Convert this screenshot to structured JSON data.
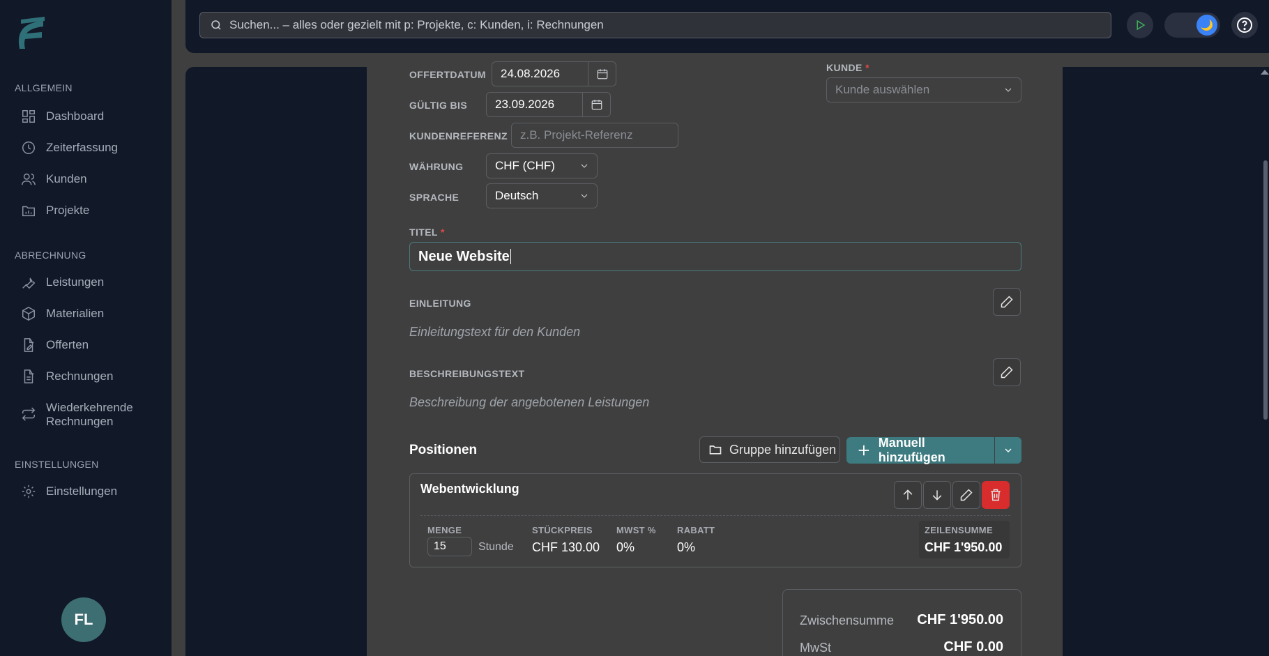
{
  "sidebar": {
    "sections": [
      {
        "label": "ALLGEMEIN"
      },
      {
        "label": "ABRECHNUNG"
      },
      {
        "label": "EINSTELLUNGEN"
      }
    ],
    "items": [
      {
        "label": "Dashboard",
        "icon": "dashboard-icon"
      },
      {
        "label": "Zeiterfassung",
        "icon": "clock-icon"
      },
      {
        "label": "Kunden",
        "icon": "users-icon"
      },
      {
        "label": "Projekte",
        "icon": "folder-chart-icon"
      },
      {
        "label": "Leistungen",
        "icon": "wrench-icon"
      },
      {
        "label": "Materialien",
        "icon": "box-icon"
      },
      {
        "label": "Offerten",
        "icon": "file-edit-icon"
      },
      {
        "label": "Rechnungen",
        "icon": "file-text-icon"
      },
      {
        "label": "Wiederkehrende",
        "label2": "Rechnungen",
        "icon": "repeat-icon"
      },
      {
        "label": "Einstellungen",
        "icon": "gear-icon"
      }
    ],
    "avatar": "FL"
  },
  "search": {
    "placeholder": "Suchen... – alles oder gezielt mit p: Projekte, c: Kunden, i: Rechnungen"
  },
  "colors": {
    "accent": "#3d7b80",
    "danger": "#d92c2c",
    "sidebar_bg": "#111828",
    "card_bg": "#3f3f3f"
  },
  "form": {
    "offertdatum": {
      "label": "OFFERTDATUM",
      "value": "24.08.2026"
    },
    "gueltig_bis": {
      "label": "GÜLTIG BIS",
      "value": "23.09.2026"
    },
    "kundenreferenz": {
      "label": "KUNDENREFERENZ",
      "placeholder": "z.B. Projekt-Referenz"
    },
    "waehrung": {
      "label": "WÄHRUNG",
      "value": "CHF (CHF)"
    },
    "sprache": {
      "label": "SPRACHE",
      "value": "Deutsch"
    },
    "kunde": {
      "label": "KUNDE",
      "required": "*",
      "placeholder": "Kunde auswählen"
    },
    "titel": {
      "label": "TITEL",
      "required": "*",
      "value": "Neue Website"
    },
    "einleitung": {
      "label": "EINLEITUNG",
      "placeholder": "Einleitungstext für den Kunden"
    },
    "beschreibung": {
      "label": "BESCHREIBUNGSTEXT",
      "placeholder": "Beschreibung der angebotenen Leistungen"
    }
  },
  "positionen": {
    "title": "Positionen",
    "add_group": "Gruppe hinzufügen",
    "add_manual": "Manuell hinzufügen",
    "items": [
      {
        "name": "Webentwicklung",
        "menge_label": "MENGE",
        "menge": "15",
        "unit": "Stunde",
        "stueckpreis_label": "STÜCKPREIS",
        "stueckpreis": "CHF 130.00",
        "mwst_label": "MWST %",
        "mwst": "0%",
        "rabatt_label": "RABATT",
        "rabatt": "0%",
        "zeilensumme_label": "ZEILENSUMME",
        "zeilensumme": "CHF 1'950.00"
      }
    ]
  },
  "totals": {
    "zwischensumme_label": "Zwischensumme",
    "zwischensumme": "CHF 1'950.00",
    "mwst_label": "MwSt",
    "mwst": "CHF 0.00"
  }
}
